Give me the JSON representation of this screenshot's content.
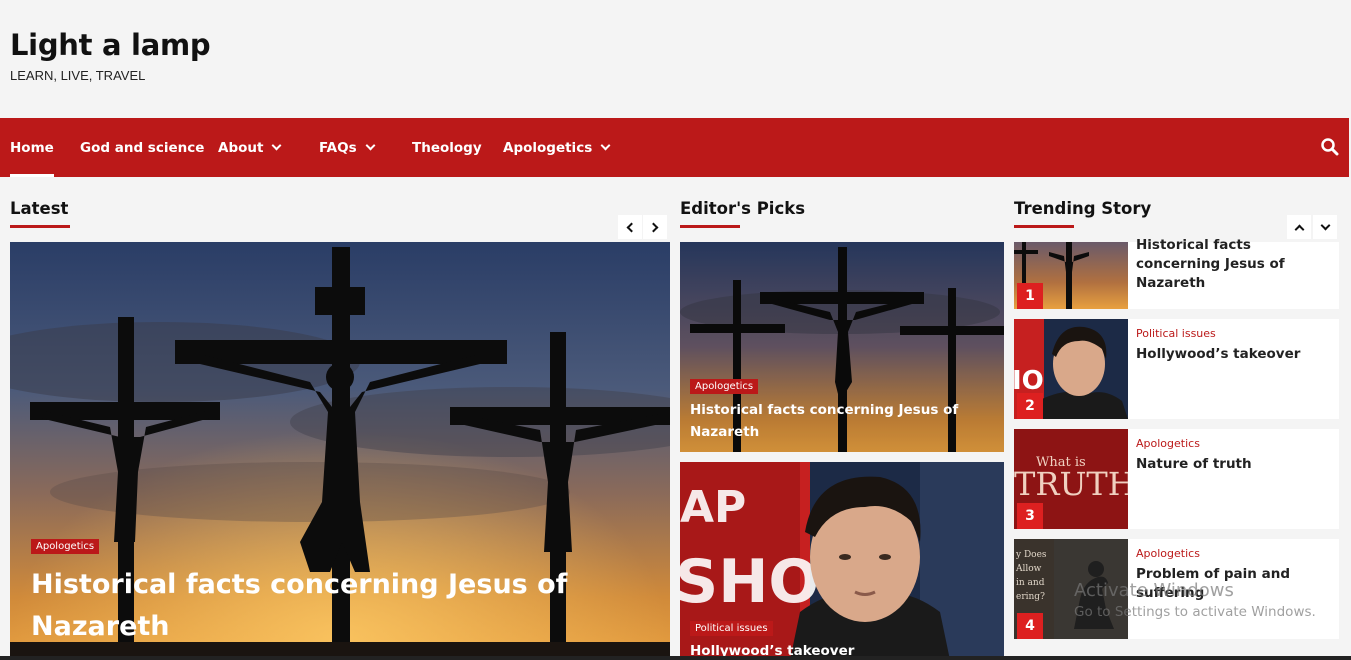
{
  "site": {
    "title": "Light a lamp",
    "tagline": "LEARN, LIVE, TRAVEL"
  },
  "nav": {
    "items": [
      {
        "label": "Home",
        "active": true
      },
      {
        "label": "God and science"
      },
      {
        "label": "About",
        "dropdown": true
      },
      {
        "label": "FAQs",
        "dropdown": true
      },
      {
        "label": "Theology"
      },
      {
        "label": "Apologetics",
        "dropdown": true
      }
    ],
    "search_icon": "search-icon"
  },
  "latest": {
    "section_title": "Latest",
    "category": "Apologetics",
    "title": "Historical facts concerning Jesus of Nazareth"
  },
  "editors_picks": {
    "section_title": "Editor's Picks",
    "items": [
      {
        "category": "Apologetics",
        "title": "Historical facts concerning Jesus of Nazareth"
      },
      {
        "category": "Political issues",
        "title": "Hollywood’s takeover"
      }
    ]
  },
  "trending": {
    "section_title": "Trending Story",
    "items": [
      {
        "num": "1",
        "category": "",
        "title": "Historical facts concerning Jesus of Nazareth"
      },
      {
        "num": "2",
        "category": "Political issues",
        "title": "Hollywood’s takeover"
      },
      {
        "num": "3",
        "category": "Apologetics",
        "title": "Nature of truth"
      },
      {
        "num": "4",
        "category": "Apologetics",
        "title": "Problem of pain and suffering"
      }
    ]
  },
  "thumb_text": {
    "truth_small": "What is",
    "truth_big": "TRUTH?",
    "pain_text": "y Does / Allow / in and / ering?",
    "show_text": "SHO"
  },
  "watermark": {
    "line1": "Activate Windows",
    "line2": "Go to Settings to activate Windows."
  },
  "colors": {
    "accent": "#bb1919",
    "number_badge": "#dd2020",
    "background": "#f4f4f4"
  }
}
